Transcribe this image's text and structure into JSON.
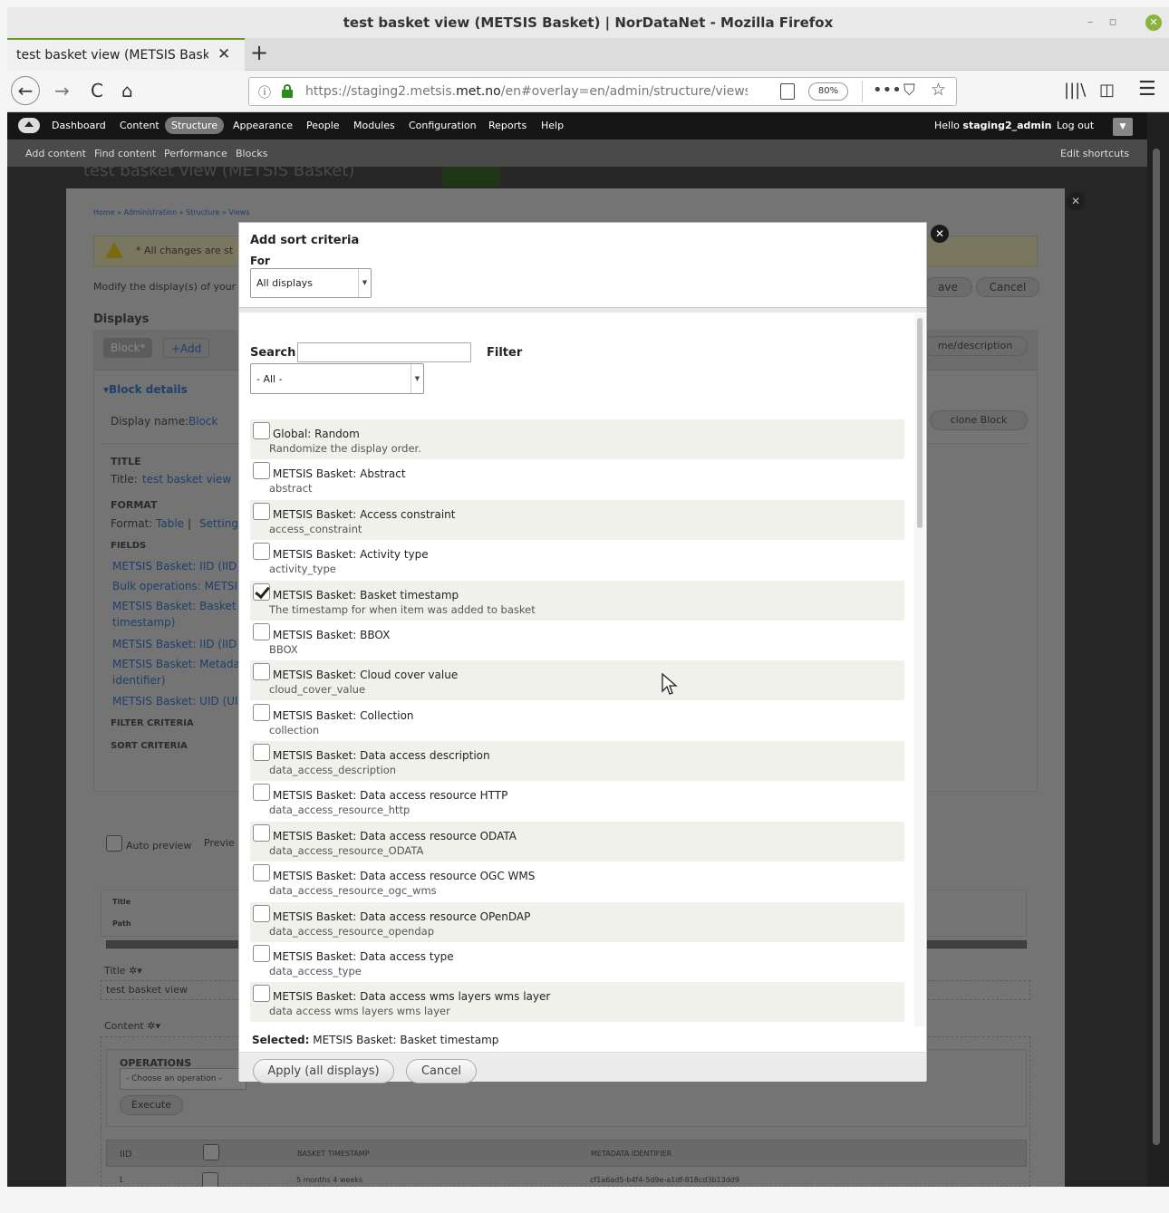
{
  "window": {
    "title": "test basket view (METSIS Basket) | NorDataNet - Mozilla Firefox",
    "controls": {
      "minimize": "–",
      "maximize": "▫",
      "close": "✕"
    }
  },
  "tab": {
    "label": "test basket view (METSIS Basket)",
    "close": "✕",
    "new_tab": "+"
  },
  "nav": {
    "back": "←",
    "forward": "→",
    "reload": "C",
    "home": "⌂",
    "url_prefix": "https://staging2.metsis.",
    "url_domain": "met.no",
    "url_rest": "/en#overlay=en/admin/structure/views/view",
    "zoom": "80%",
    "more": "•••",
    "info_icon": "ⓘ",
    "pocket": "⛉",
    "star": "☆",
    "library": "|||\\",
    "sidebar": "◫",
    "menu": "☰"
  },
  "admin_toolbar": {
    "items": [
      "Dashboard",
      "Content",
      "Structure",
      "Appearance",
      "People",
      "Modules",
      "Configuration",
      "Reports",
      "Help"
    ],
    "hello_prefix": "Hello ",
    "user": "staging2_admin",
    "logout": "Log out",
    "drop": "▼"
  },
  "shortcuts": {
    "items": [
      "Add content",
      "Find content",
      "Performance",
      "Blocks"
    ],
    "edit": "Edit shortcuts"
  },
  "background": {
    "page_title": "test basket view (METSIS Basket)",
    "breadcrumb": "Home » Administration » Structure » Views",
    "warning": "* All changes are st",
    "modify_text": "Modify the display(s) of your",
    "save": "ave",
    "cancel": "Cancel",
    "displays_heading": "Displays",
    "block_tab": "Block*",
    "add_tab": "+Add",
    "name_desc": "me/description",
    "block_details": "▾Block details",
    "display_name_label": "Display name:",
    "display_name_value": "Block",
    "clone_block": "clone Block",
    "title_heading": "TITLE",
    "title_label": "Title:",
    "title_value": "test basket view",
    "format_heading": "FORMAT",
    "format_label": "Format:",
    "format_value": "Table",
    "format_sep": "|",
    "settings": "Settings",
    "fields_heading": "FIELDS",
    "fields": [
      "METSIS Basket: IID (IID)",
      "Bulk operations: METSIS",
      "METSIS Basket: Basket t",
      "timestamp)",
      "METSIS Basket: IID (IID)",
      "METSIS Basket: Metadat",
      "identifier)",
      "METSIS Basket: UID (UID"
    ],
    "filter_heading": "FILTER CRITERIA",
    "sort_heading": "SORT CRITERIA",
    "auto_preview": "Auto preview",
    "preview": "Previe",
    "table_title": "Title",
    "table_path": "Path",
    "title_gear": "Title ✲▾",
    "title_text": "test basket view",
    "content_gear": "Content ✲▾",
    "operations": "OPERATIONS",
    "choose_op": "- Choose an operation -",
    "execute": "Execute",
    "col_iid": "IID",
    "col_basket": "BASKET TIMESTAMP",
    "col_meta": "METADATA IDENTIFIER",
    "row_iid": "1",
    "row_basket": "5 months 4 weeks",
    "row_meta": "cf1a6ad5-b4f4-5d9e-a1df-818cd3b13dd9"
  },
  "modal": {
    "title": "Add sort criteria",
    "for_label": "For",
    "for_value": "All displays",
    "search_label": "Search",
    "search_value": "",
    "filter_label": "Filter",
    "filter_value": "- All -",
    "items": [
      {
        "label": "Global: Random",
        "desc": "Randomize the display order."
      },
      {
        "label": "METSIS Basket: Abstract",
        "desc": "abstract"
      },
      {
        "label": "METSIS Basket: Access constraint",
        "desc": "access_constraint"
      },
      {
        "label": "METSIS Basket: Activity type",
        "desc": "activity_type"
      },
      {
        "label": "METSIS Basket: Basket timestamp",
        "desc": "The timestamp for when item was added to basket",
        "checked": true
      },
      {
        "label": "METSIS Basket: BBOX",
        "desc": "BBOX"
      },
      {
        "label": "METSIS Basket: Cloud cover value",
        "desc": "cloud_cover_value"
      },
      {
        "label": "METSIS Basket: Collection",
        "desc": "collection"
      },
      {
        "label": "METSIS Basket: Data access description",
        "desc": "data_access_description"
      },
      {
        "label": "METSIS Basket: Data access resource HTTP",
        "desc": "data_access_resource_http"
      },
      {
        "label": "METSIS Basket: Data access resource ODATA",
        "desc": "data_access_resource_ODATA"
      },
      {
        "label": "METSIS Basket: Data access resource OGC WMS",
        "desc": "data_access_resource_ogc_wms"
      },
      {
        "label": "METSIS Basket: Data access resource OPenDAP",
        "desc": "data_access_resource_opendap"
      },
      {
        "label": "METSIS Basket: Data access type",
        "desc": "data_access_type"
      },
      {
        "label": "METSIS Basket: Data access wms layers wms layer",
        "desc": "data access wms layers wms layer"
      }
    ],
    "selected_label": "Selected:",
    "selected_value": "METSIS Basket: Basket timestamp",
    "apply_button": "Apply (all displays)",
    "cancel_button": "Cancel",
    "close_icon": "✕"
  }
}
